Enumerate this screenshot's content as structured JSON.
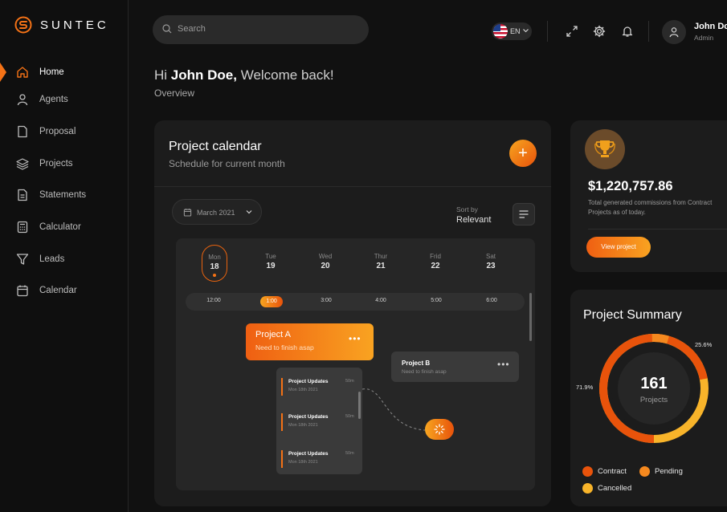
{
  "brand": {
    "name": "SUNTEC"
  },
  "sidebar": {
    "items": [
      {
        "label": "Home",
        "icon": "home-icon",
        "active": true
      },
      {
        "label": "Agents",
        "icon": "user-icon",
        "active": false
      },
      {
        "label": "Proposal",
        "icon": "file-icon",
        "active": false
      },
      {
        "label": "Projects",
        "icon": "layers-icon",
        "active": false
      },
      {
        "label": "Statements",
        "icon": "document-icon",
        "active": false
      },
      {
        "label": "Calculator",
        "icon": "calculator-icon",
        "active": false
      },
      {
        "label": "Leads",
        "icon": "filter-icon",
        "active": false
      },
      {
        "label": "Calendar",
        "icon": "calendar-icon",
        "active": false
      }
    ]
  },
  "header": {
    "search_placeholder": "Search",
    "language": "EN",
    "user_name": "John Doe",
    "user_role": "Admin"
  },
  "greeting": {
    "prefix": "Hi",
    "name": "John Doe,",
    "suffix": "Welcome back!",
    "subtitle": "Overview"
  },
  "calendar": {
    "title": "Project calendar",
    "subtitle": "Schedule for current month",
    "month": "March 2021",
    "sort_label": "Sort by",
    "sort_value": "Relevant",
    "days": [
      {
        "name": "Mon",
        "date": "18",
        "active": true
      },
      {
        "name": "Tue",
        "date": "19",
        "active": false
      },
      {
        "name": "Wed",
        "date": "20",
        "active": false
      },
      {
        "name": "Thur",
        "date": "21",
        "active": false
      },
      {
        "name": "Frid",
        "date": "22",
        "active": false
      },
      {
        "name": "Sat",
        "date": "23",
        "active": false
      }
    ],
    "times": [
      "12:00",
      "1:00",
      "3:00",
      "4:00",
      "5:00",
      "6:00"
    ],
    "active_time": "1:00",
    "project_a": {
      "title": "Project A",
      "subtitle": "Need to finish asap"
    },
    "project_b": {
      "title": "Project B",
      "subtitle": "Need to finish asap"
    },
    "updates": [
      {
        "title": "Project Updates",
        "date": "Mon 18th 2021",
        "duration": "50m"
      },
      {
        "title": "Project Updates",
        "date": "Mon 18th 2021",
        "duration": "50m"
      },
      {
        "title": "Project Updates",
        "date": "Mon 18th 2021",
        "duration": "50m"
      }
    ]
  },
  "commission": {
    "amount": "$1,220,757.86",
    "description": "Total generated commissions from Contract Projects as of today.",
    "button": "View project"
  },
  "summary": {
    "title": "Project Summary",
    "total": "161",
    "total_label": "Projects",
    "pct_left": "71.9%",
    "pct_right": "25.6%",
    "legend": [
      {
        "label": "Contract",
        "color": "#e8530b"
      },
      {
        "label": "Pending",
        "color": "#f5891f"
      },
      {
        "label": "Cancelled",
        "color": "#f8b42a"
      }
    ]
  },
  "colors": {
    "accent": "#f47216",
    "background": "#111111",
    "card": "#1c1c1c"
  }
}
